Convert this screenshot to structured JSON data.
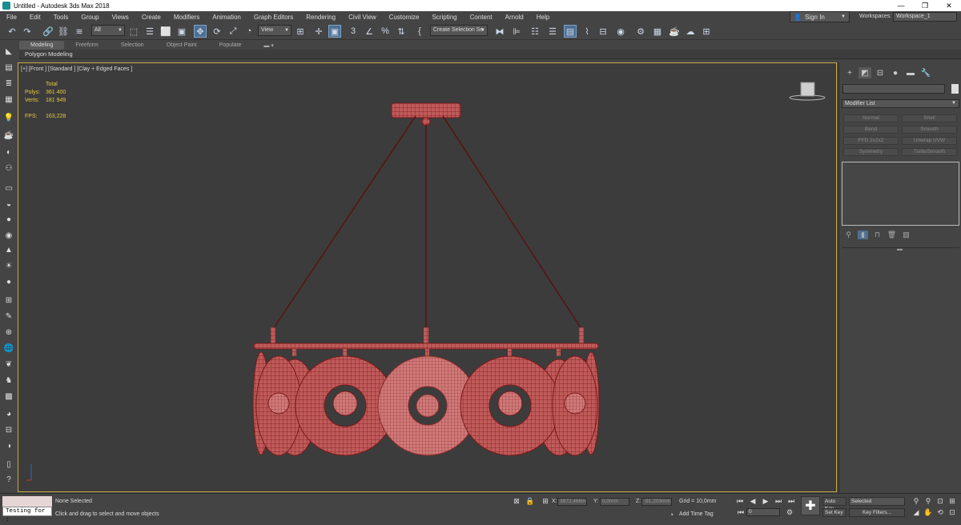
{
  "window": {
    "title": "Untitled - Autodesk 3ds Max 2018",
    "minimize": "—",
    "maximize": "❐",
    "close": "✕"
  },
  "menu": [
    "File",
    "Edit",
    "Tools",
    "Group",
    "Views",
    "Create",
    "Modifiers",
    "Animation",
    "Graph Editors",
    "Rendering",
    "Civil View",
    "Customize",
    "Scripting",
    "Content",
    "Arnold",
    "Help"
  ],
  "account": {
    "sign_in": "Sign In",
    "workspaces_label": "Workspaces:",
    "workspace": "Workspace_1"
  },
  "toolbar": {
    "selection_filter": "All",
    "ref_coord": "View",
    "selection_set": "Create Selection Se"
  },
  "ribbon": {
    "tabs": [
      "Modeling",
      "Freeform",
      "Selection",
      "Object Paint",
      "Populate"
    ],
    "active": "Modeling",
    "panel": "Polygon Modeling"
  },
  "viewport": {
    "label": "[+] [Front ] [Standard ] [Clay + Edged Faces ]"
  },
  "stats": {
    "header": "Total",
    "polys_label": "Polys:",
    "polys": "361 400",
    "verts_label": "Verts:",
    "verts": "181 949",
    "fps_label": "FPS:",
    "fps": "163,228"
  },
  "command_panel": {
    "modifier_list": "Modifier List",
    "modifiers": [
      "Normal",
      "Shell",
      "Bend",
      "Smooth",
      "FFD 2x2x2",
      "Unwrap UVW",
      "Symmetry",
      "TurboSmooth"
    ]
  },
  "status": {
    "selection": "None Selected",
    "prompt": "Click and drag to select and move objects",
    "maxscript": "Testing for :",
    "x_label": "X:",
    "x": "3872,466m",
    "y_label": "Y:",
    "y": "0,0mm",
    "z_label": "Z:",
    "z": "-91,203mm",
    "grid": "Grid = 10,0mm",
    "add_time_tag": "Add Time Tag",
    "frame": "0",
    "auto_key": "Auto Key",
    "set_key": "Set Key",
    "key_mode": "Selected",
    "key_filters": "Key Filters..."
  },
  "colors": {
    "viewport_bg": "#3c3c3c",
    "wire": "#7a1a1a",
    "mesh": "#c05b5b",
    "stats_text": "#e8c940",
    "active_blue": "#4d6f93"
  }
}
